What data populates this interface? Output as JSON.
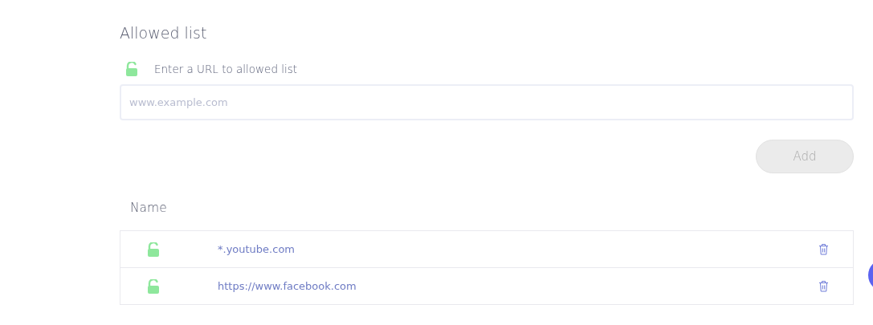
{
  "section": {
    "title": "Allowed list"
  },
  "input_label": "Enter a URL to allowed list",
  "url_field": {
    "placeholder": "www.example.com"
  },
  "add_button": {
    "label": "Add",
    "disabled": true
  },
  "table": {
    "columns": [
      "Name"
    ],
    "rows": [
      {
        "name": "*.youtube.com"
      },
      {
        "name": "https://www.facebook.com"
      }
    ]
  }
}
